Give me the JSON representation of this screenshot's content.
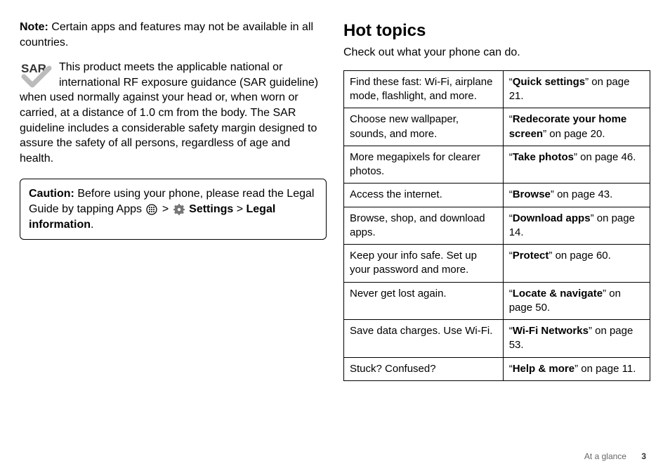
{
  "left": {
    "note_label": "Note:",
    "note_text": " Certain apps and features may not be available in all countries.",
    "sar_badge_text": "SAR",
    "sar_text": "This product meets the applicable national or international RF exposure guidance (SAR guideline) when used normally against your head or, when worn or carried, at a distance of 1.0 cm from the body. The SAR guideline includes a considerable safety margin designed to assure the safety of all persons, regardless of age and health.",
    "caution_label": "Caution:",
    "caution_pre": " Before using your phone, please read the Legal Guide by tapping Apps ",
    "caution_gt1": " > ",
    "caution_settings": "Settings",
    "caution_gt2": " > ",
    "caution_legal": "Legal information",
    "caution_end": "."
  },
  "right": {
    "heading": "Hot topics",
    "sub": "Check out what your phone can do.",
    "rows": [
      {
        "desc": "Find these fast: Wi-Fi, airplane mode, flashlight, and more.",
        "q1": "“",
        "link": "Quick settings",
        "q2": "” on page 21."
      },
      {
        "desc": "Choose new wallpaper, sounds, and more.",
        "q1": "“",
        "link": "Redecorate your home screen",
        "q2": "” on page 20."
      },
      {
        "desc": "More megapixels for clearer photos.",
        "q1": "“",
        "link": "Take photos",
        "q2": "” on page 46."
      },
      {
        "desc": "Access the internet.",
        "q1": "“",
        "link": "Browse",
        "q2": "” on page 43."
      },
      {
        "desc": "Browse, shop, and download apps.",
        "q1": "“",
        "link": "Download apps",
        "q2": "” on page 14."
      },
      {
        "desc": "Keep your info safe. Set up your password and more.",
        "q1": "“",
        "link": "Protect",
        "q2": "” on page 60."
      },
      {
        "desc": "Never get lost again.",
        "q1": "“",
        "link": "Locate & navigate",
        "q2": "” on page 50."
      },
      {
        "desc": "Save data charges. Use Wi-Fi.",
        "q1": "“",
        "link": "Wi-Fi Networks",
        "q2": "” on page 53."
      },
      {
        "desc": "Stuck? Confused?",
        "q1": "“",
        "link": "Help & more",
        "q2": "” on page 11."
      }
    ]
  },
  "footer": {
    "section": "At a glance",
    "page": "3"
  }
}
